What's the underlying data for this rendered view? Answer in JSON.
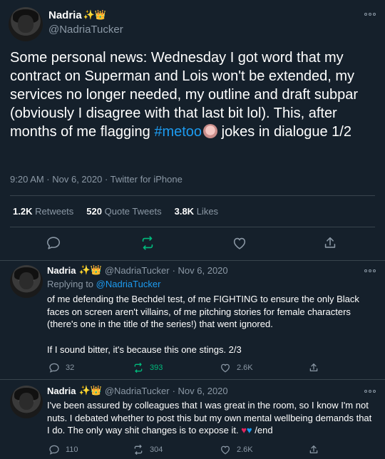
{
  "main_tweet": {
    "author_name": "Nadria",
    "author_emoji": "✨👑",
    "handle": "@NadriaTucker",
    "text_part1": "Some personal news: Wednesday I got word that my contract on Superman and Lois won't be extended, my services no longer needed, my outline and draft subpar (obviously I disagree with that last bit lol). This, after months of me flagging ",
    "hashtag": "#metoo",
    "text_part2": " jokes in dialogue 1/2",
    "timestamp": "9:20 AM · Nov 6, 2020 · Twitter for iPhone",
    "retweets_count": "1.2K",
    "retweets_label": "Retweets",
    "quotes_count": "520",
    "quotes_label": "Quote Tweets",
    "likes_count": "3.8K",
    "likes_label": "Likes"
  },
  "replies": [
    {
      "author_name": "Nadria",
      "author_emoji": "✨👑",
      "handle": "@NadriaTucker",
      "date": "· Nov 6, 2020",
      "replying_label": "Replying to",
      "replying_to": "@NadriaTucker",
      "text": "of me defending the Bechdel test, of me FIGHTING to ensure the only Black faces on screen aren't villains, of me pitching stories for female characters (there's one in the title of the series!) that went ignored.",
      "text2": "If I sound bitter, it's because this one stings. 2/3",
      "reply_count": "32",
      "retweet_count": "393",
      "like_count": "2.6K"
    },
    {
      "author_name": "Nadria",
      "author_emoji": "✨👑",
      "handle": "@NadriaTucker",
      "date": "· Nov 6, 2020",
      "text": "I've been assured by colleagues that I was great in the room, so I know I'm not nuts. I debated whether to post this but my own mental wellbeing demands that I do. The only way shit changes is to expose it.",
      "end_text": "/end",
      "reply_count": "110",
      "retweet_count": "304",
      "like_count": "2.6K"
    }
  ],
  "colors": {
    "background": "#15202b",
    "accent": "#1d9bf0",
    "retweet_green": "#00ba7c",
    "muted": "#8b98a5"
  }
}
